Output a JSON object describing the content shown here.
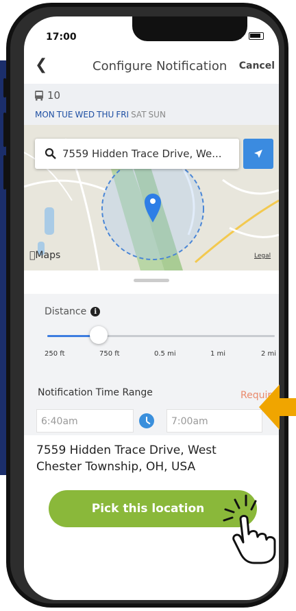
{
  "status_bar": {
    "time": "17:00"
  },
  "nav": {
    "back_icon": "chevron-left-icon",
    "title": "Configure Notification",
    "cancel": "Cancel"
  },
  "route": {
    "bus_icon": "bus-icon",
    "route_number": "10"
  },
  "days": {
    "active": [
      "MON",
      "TUE",
      "WED",
      "THU",
      "FRI"
    ],
    "inactive": [
      "SAT",
      "SUN"
    ]
  },
  "map": {
    "search_text": "7559 Hidden Trace Drive, We...",
    "maps_label": "Maps",
    "legal": "Legal"
  },
  "distance": {
    "label": "Distance",
    "ticks": [
      "250 ft",
      "750 ft",
      "0.5 mi",
      "1 mi",
      "2 mi"
    ],
    "selected_index": 1
  },
  "time_range": {
    "label": "Notification Time Range",
    "required": "Required",
    "start_placeholder": "6:40am",
    "end_placeholder": "7:00am"
  },
  "address": "7559 Hidden Trace Drive, West Chester Township, OH, USA",
  "pick_button": "Pick this location",
  "colors": {
    "accent_blue": "#3b8be0",
    "button_green": "#8ab83a",
    "required": "#e98a6c",
    "arrow": "#f0a500",
    "side_panel": "#1b2e6b"
  }
}
